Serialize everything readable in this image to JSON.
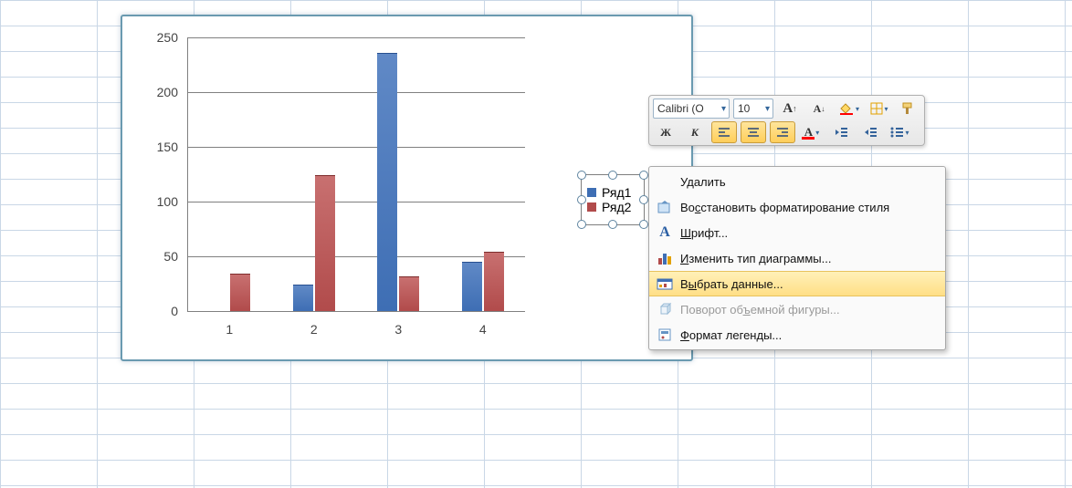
{
  "chart_data": {
    "type": "bar",
    "categories": [
      "1",
      "2",
      "3",
      "4"
    ],
    "series": [
      {
        "name": "Ряд1",
        "values": [
          0,
          23,
          235,
          44
        ],
        "color": "#3e6eb4"
      },
      {
        "name": "Ряд2",
        "values": [
          33,
          123,
          31,
          53
        ],
        "color": "#b14b4b"
      }
    ],
    "ylim": [
      0,
      250
    ],
    "ystep": 50,
    "title": "",
    "xlabel": "",
    "ylabel": ""
  },
  "mini_toolbar": {
    "font_name": "Calibri (О",
    "font_size": "10",
    "grow": "A",
    "shrink": "A",
    "bold": "Ж",
    "italic": "К"
  },
  "context_menu": {
    "items": [
      {
        "key": "delete",
        "label": "Удалить",
        "accel_index": -1,
        "disabled": false,
        "hover": false,
        "icon": "blank"
      },
      {
        "key": "reset",
        "label": "Восстановить форматирование стиля",
        "accel_index": 2,
        "disabled": false,
        "hover": false,
        "icon": "reset"
      },
      {
        "key": "font",
        "label": "Шрифт...",
        "accel_index": 0,
        "disabled": false,
        "hover": false,
        "icon": "font-A"
      },
      {
        "key": "charttype",
        "label": "Изменить тип диаграммы...",
        "accel_index": 0,
        "disabled": false,
        "hover": false,
        "icon": "chartbars"
      },
      {
        "key": "selectdata",
        "label": "Выбрать данные...",
        "accel_index": 1,
        "disabled": false,
        "hover": true,
        "icon": "selectdata"
      },
      {
        "key": "rotate3d",
        "label": "Поворот объемной фигуры...",
        "accel_index": 10,
        "disabled": true,
        "hover": false,
        "icon": "cube3d"
      },
      {
        "key": "fmt_legend",
        "label": "Формат легенды...",
        "accel_index": 0,
        "disabled": false,
        "hover": false,
        "icon": "props"
      }
    ]
  }
}
